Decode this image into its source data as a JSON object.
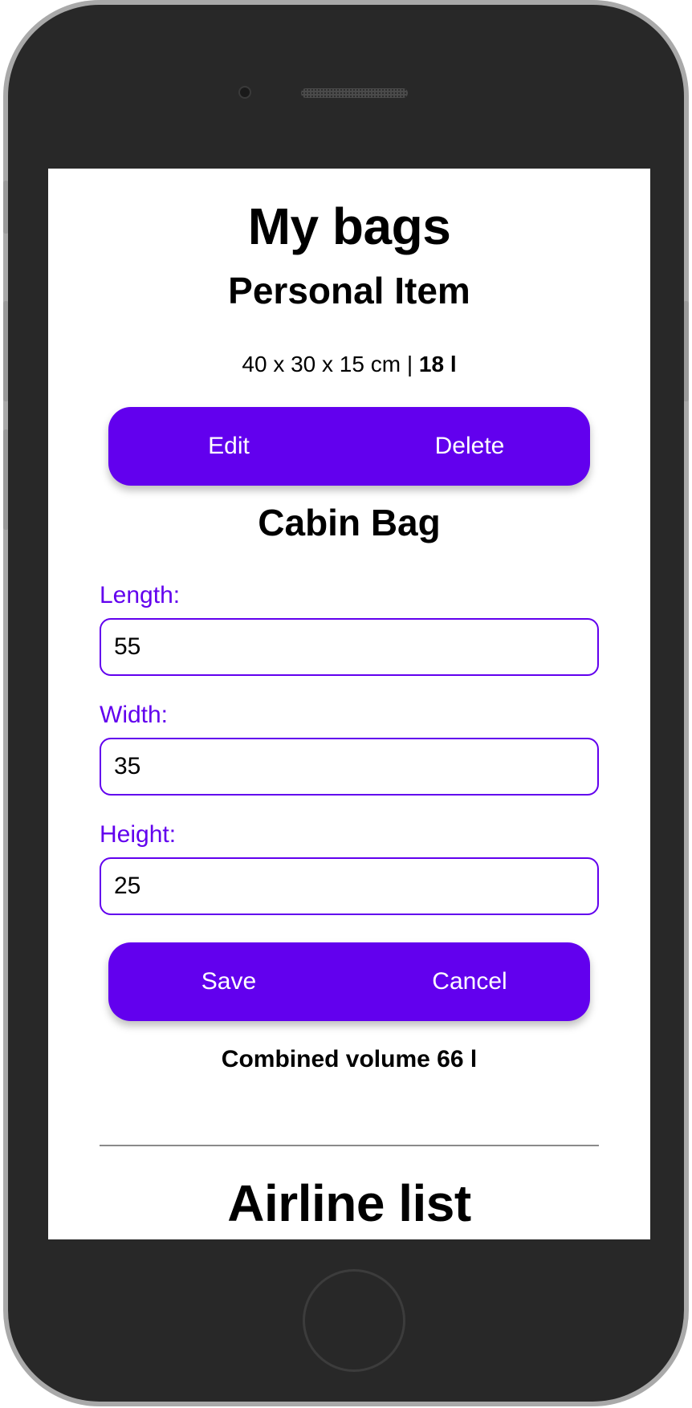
{
  "page": {
    "title": "My bags",
    "accent_color": "#6200ee"
  },
  "personal_item": {
    "title": "Personal Item",
    "dimensions": "40 x 30 x 15 cm |",
    "volume": "18 l",
    "edit_label": "Edit",
    "delete_label": "Delete"
  },
  "cabin_bag": {
    "title": "Cabin Bag",
    "length_label": "Length:",
    "length_value": "55",
    "width_label": "Width:",
    "width_value": "35",
    "height_label": "Height:",
    "height_value": "25",
    "save_label": "Save",
    "cancel_label": "Cancel"
  },
  "combined_volume": "Combined volume 66 l",
  "airline_list": {
    "title": "Airline list"
  }
}
